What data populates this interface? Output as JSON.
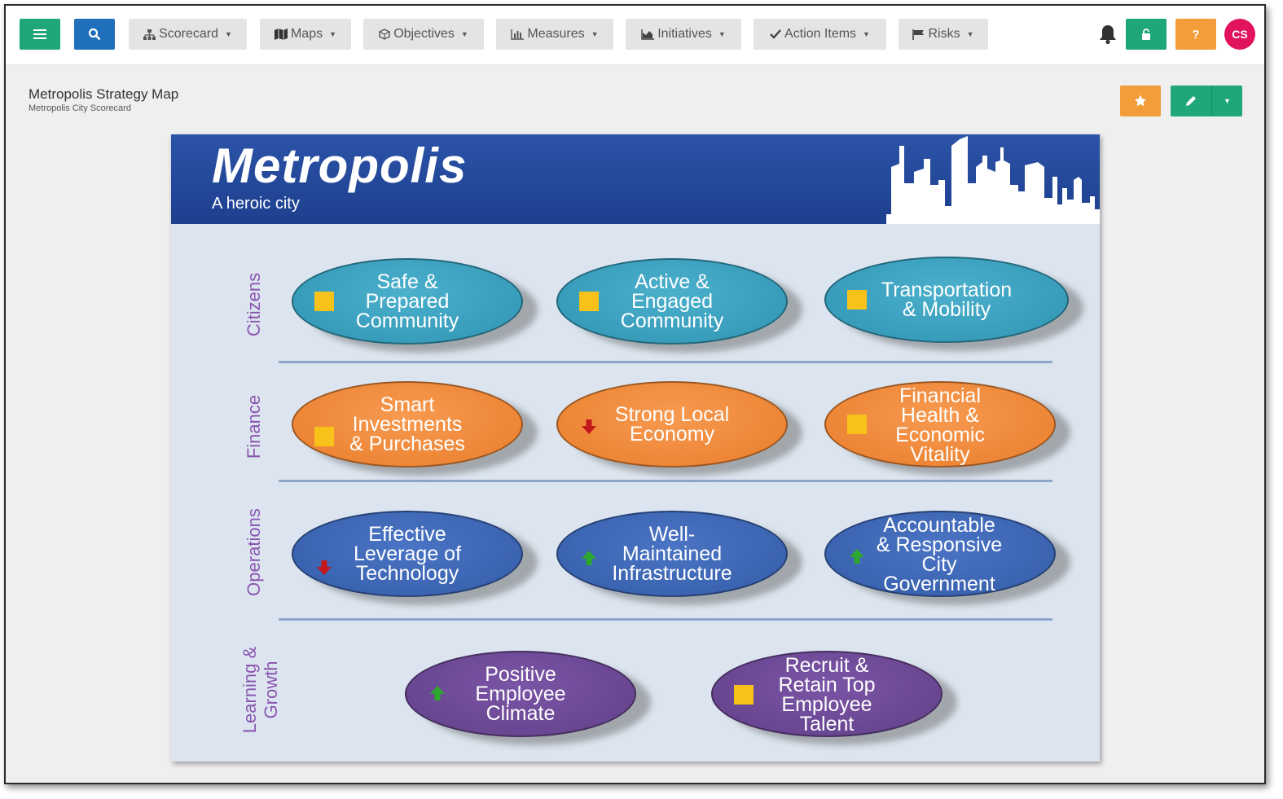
{
  "navbar": {
    "menu_icon": "hamburger-icon",
    "search_icon": "search-icon",
    "dropdowns": [
      {
        "label": "Scorecard",
        "icon": "hierarchy-icon"
      },
      {
        "label": "Maps",
        "icon": "map-icon"
      },
      {
        "label": "Objectives",
        "icon": "cube-icon"
      },
      {
        "label": "Measures",
        "icon": "bar-chart-icon"
      },
      {
        "label": "Initiatives",
        "icon": "area-chart-icon"
      },
      {
        "label": "Action Items",
        "icon": "check-icon"
      },
      {
        "label": "Risks",
        "icon": "flag-icon"
      }
    ],
    "bell_icon": "bell-icon",
    "unlock_icon": "unlock-icon",
    "help_label": "?",
    "avatar_initials": "CS"
  },
  "page": {
    "title": "Metropolis Strategy Map",
    "subtitle": "Metropolis City Scorecard"
  },
  "map": {
    "title": "Metropolis",
    "tagline": "A heroic city",
    "perspectives": [
      "Citizens",
      "Finance",
      "Operations",
      "Learning &\nGrowth"
    ],
    "objectives": {
      "citizens": [
        {
          "label": "Safe &\nPrepared\nCommunity",
          "status": "square"
        },
        {
          "label": "Active &\nEngaged\nCommunity",
          "status": "square"
        },
        {
          "label": "Transportation\n& Mobility",
          "status": "square"
        }
      ],
      "finance": [
        {
          "label": "Smart\nInvestments\n& Purchases",
          "status": "square"
        },
        {
          "label": "Strong Local\nEconomy",
          "status": "down"
        },
        {
          "label": "Financial\nHealth &\nEconomic\nVitality",
          "status": "square"
        }
      ],
      "operations": [
        {
          "label": "Effective\nLeverage of\nTechnology",
          "status": "down"
        },
        {
          "label": "Well-\nMaintained\nInfrastructure",
          "status": "up"
        },
        {
          "label": "Accountable\n& Responsive\nCity\nGovernment",
          "status": "up"
        }
      ],
      "learning": [
        {
          "label": "Positive\nEmployee\nClimate",
          "status": "up"
        },
        {
          "label": "Recruit &\nRetain Top\nEmployee\nTalent",
          "status": "square"
        }
      ]
    },
    "colors": {
      "banner": "#1d3f8e",
      "citizens": "#2f94b3",
      "finance": "#e97d2b",
      "operations": "#345ca8",
      "learning": "#624088",
      "status_yellow": "#f8c21b",
      "status_up": "#2ea72e",
      "status_down": "#c4161c"
    }
  }
}
